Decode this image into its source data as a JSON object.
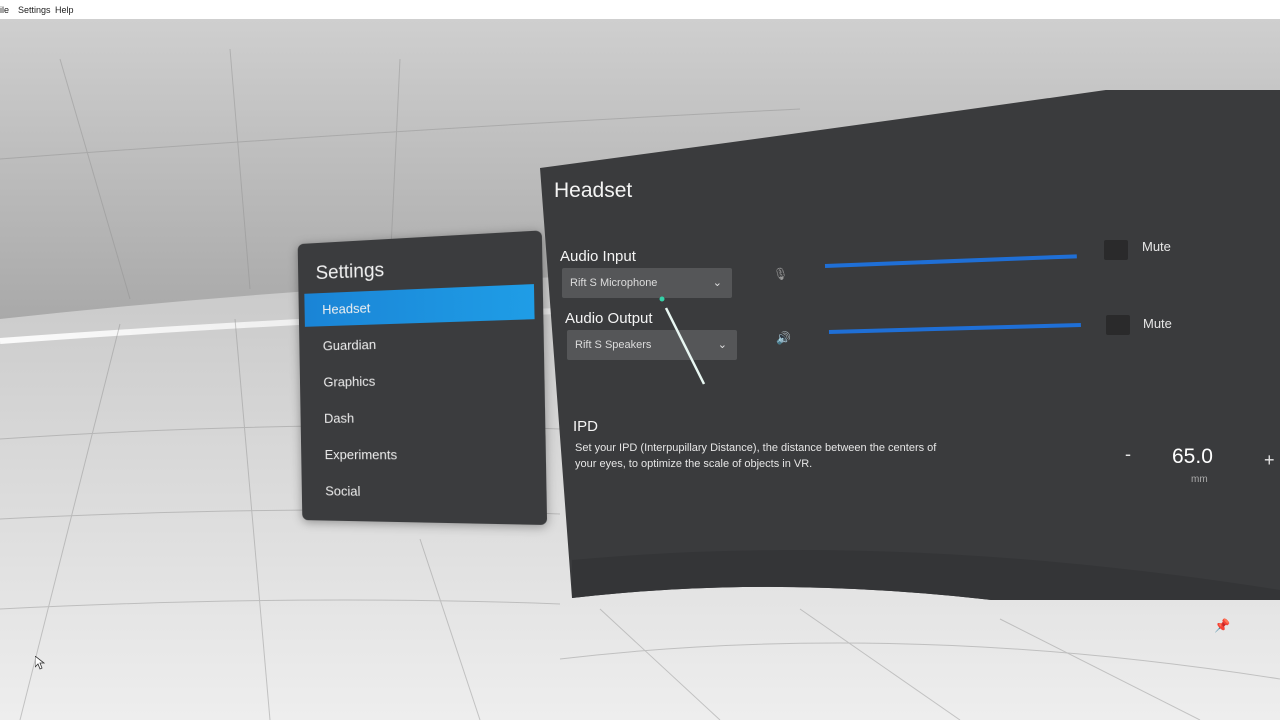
{
  "menubar": {
    "items": [
      "ile",
      "Settings",
      "Help"
    ]
  },
  "settings_menu": {
    "title": "Settings",
    "items": [
      {
        "label": "Headset",
        "active": true
      },
      {
        "label": "Guardian",
        "active": false
      },
      {
        "label": "Graphics",
        "active": false
      },
      {
        "label": "Dash",
        "active": false
      },
      {
        "label": "Experiments",
        "active": false
      },
      {
        "label": "Social",
        "active": false
      }
    ]
  },
  "headset": {
    "title": "Headset",
    "audio_input": {
      "label": "Audio Input",
      "device": "Rift S Microphone",
      "icon": "microphone-icon",
      "level": 1.0,
      "mute_label": "Mute"
    },
    "audio_output": {
      "label": "Audio Output",
      "device": "Rift S Speakers",
      "icon": "speaker-icon",
      "level": 1.0,
      "mute_label": "Mute"
    },
    "ipd": {
      "title": "IPD",
      "description": "Set your IPD (Interpupillary Distance), the distance between the centers of your eyes, to optimize the scale of objects in VR.",
      "value": "65.0",
      "unit": "mm",
      "decrement": "-",
      "increment": "+"
    }
  },
  "colors": {
    "accent": "#1a84d6",
    "panel": "#3b3c3e",
    "slider": "#1f6fd6"
  }
}
